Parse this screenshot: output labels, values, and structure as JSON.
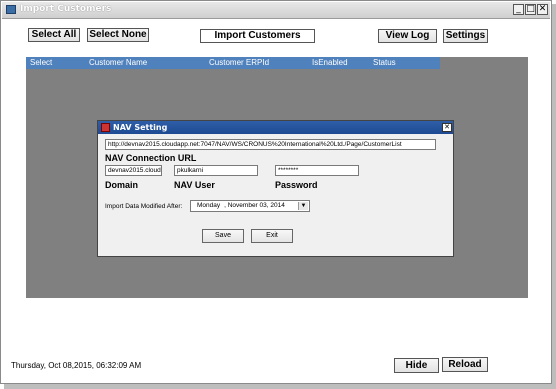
{
  "window": {
    "title": "Import Customers",
    "minimize": "_",
    "restore": "□",
    "close": "✕"
  },
  "toolbar": {
    "select_all": "Select All",
    "select_none": "Select None",
    "import_customers": "Import Customers",
    "view_log": "View Log",
    "settings": "Settings"
  },
  "grid": {
    "columns": [
      "Select",
      "Customer Name",
      "Customer ERPId",
      "IsEnabled",
      "Status"
    ]
  },
  "dialog": {
    "title": "NAV Setting",
    "close": "✕",
    "url_value": "http://devnav2015.cloudapp.net:7047/NAV/WS/CRONUS%20International%20Ltd./Page/CustomerList",
    "url_label": "NAV Connection URL",
    "domain_value": "devnav2015.cloud",
    "user_value": "pkulkarni",
    "password_value": "********",
    "domain_label": "Domain",
    "user_label": "NAV User",
    "password_label": "Password",
    "import_label": "Import Data Modified After:",
    "date_day": "Monday",
    "date_rest": ", November 03, 2014",
    "save": "Save",
    "exit": "Exit"
  },
  "status_text": "Thursday, Oct 08,2015, 06:32:09 AM",
  "bottom": {
    "hide": "Hide",
    "reload": "Reload"
  }
}
